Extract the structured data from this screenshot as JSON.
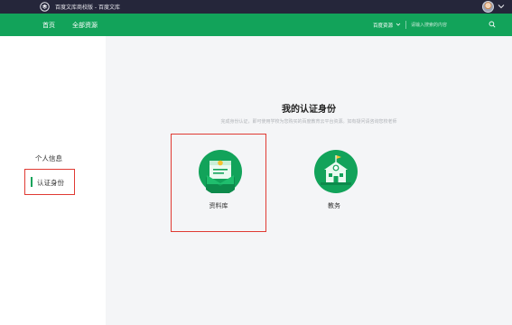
{
  "colors": {
    "topbar_bg": "#25263a",
    "brand_green": "#12a35a",
    "highlight_red": "#e03a33",
    "main_bg": "#f4f5f7"
  },
  "topbar": {
    "brand": "百度文库商校版 - 百度文库",
    "logo_icon": "baidu-wenku-logo",
    "avatar": "user-avatar",
    "menu_icon": "chevron-down-icon"
  },
  "nav": {
    "home": "首页",
    "all_resources": "全部资源",
    "category": "百度资源",
    "search_placeholder": "请输入搜索的内容",
    "search_icon": "search-icon"
  },
  "sidebar": {
    "items": [
      {
        "label": "个人信息"
      },
      {
        "label": "认证身份"
      }
    ]
  },
  "main": {
    "title": "我的认证身份",
    "subtitle": "完成身份认证，即可使用学校为您购买的百度教育云平台资源。如有疑问请咨询您校老师",
    "cards": [
      {
        "label": "资料库",
        "icon": "document-library-icon"
      },
      {
        "label": "教务",
        "icon": "school-building-icon"
      }
    ]
  }
}
